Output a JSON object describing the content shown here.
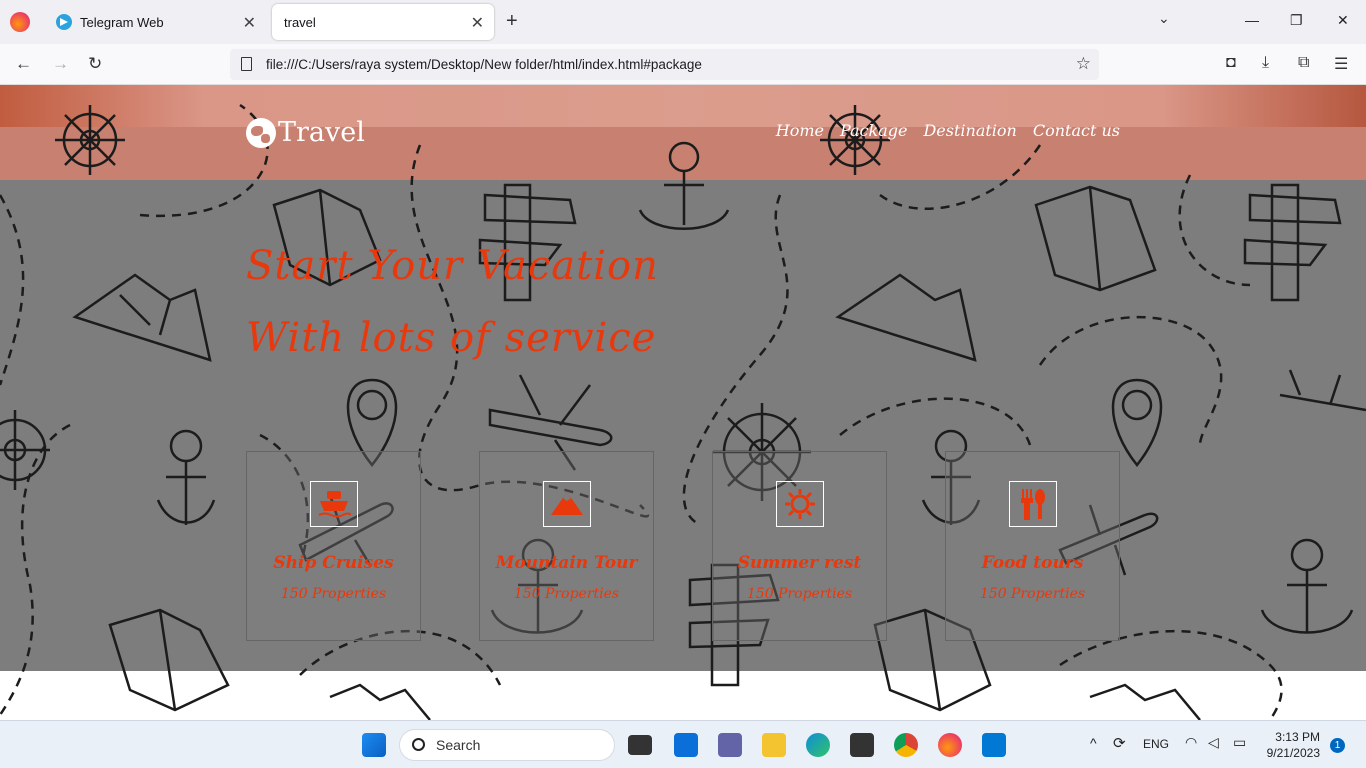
{
  "browser": {
    "tabs": [
      {
        "title": "Telegram Web",
        "active": false
      },
      {
        "title": "travel",
        "active": true
      }
    ],
    "url": "file:///C:/Users/raya system/Desktop/New folder/html/index.html#package"
  },
  "site": {
    "logo_text": "Travel",
    "nav": [
      "Home",
      "Package",
      "Destination",
      "Contact us"
    ],
    "headline_line1": "Start Your Vacation",
    "headline_line2": "With lots of service",
    "cards": [
      {
        "title": "Ship Cruises",
        "subtitle": "150 Properties",
        "icon": "ship-icon"
      },
      {
        "title": "Mountain Tour",
        "subtitle": "150 Properties",
        "icon": "mountain-icon"
      },
      {
        "title": "Summer rest",
        "subtitle": "150 Properties",
        "icon": "sun-icon"
      },
      {
        "title": "Food tours",
        "subtitle": "150 Properties",
        "icon": "fork-spoon-icon"
      }
    ],
    "accent_color": "#e8380c"
  },
  "taskbar": {
    "search_placeholder": "Search",
    "language": "ENG",
    "time": "3:13 PM",
    "date": "9/21/2023",
    "notifications": "1"
  }
}
